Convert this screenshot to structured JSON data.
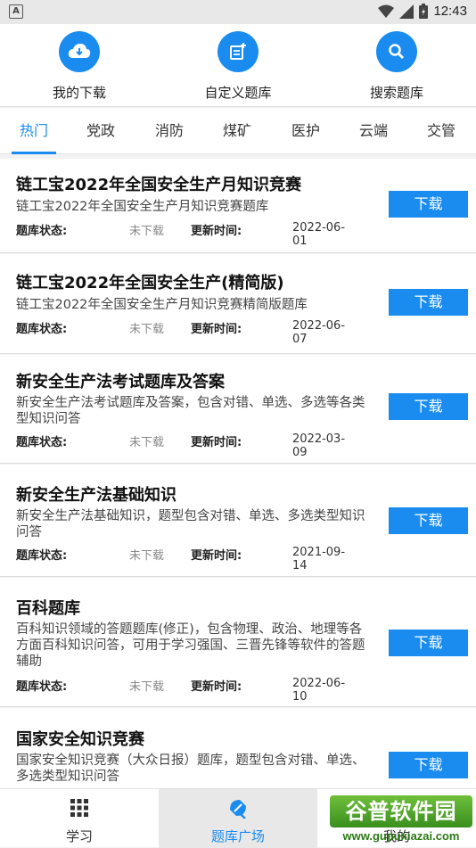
{
  "status_bar": {
    "notification_glyph": "A",
    "time": "12:43"
  },
  "quick_actions": [
    {
      "label": "我的下载",
      "icon": "cloud-download-icon"
    },
    {
      "label": "自定义题库",
      "icon": "add-note-icon"
    },
    {
      "label": "搜索题库",
      "icon": "search-icon"
    }
  ],
  "tabs": [
    "热门",
    "党政",
    "消防",
    "煤矿",
    "医护",
    "云端",
    "交管"
  ],
  "active_tab": "热门",
  "labels": {
    "status_key": "题库状态:",
    "update_key": "更新时间:",
    "download_button": "下载"
  },
  "items": [
    {
      "title": "链工宝2022年全国安全生产月知识竞赛",
      "desc": "链工宝2022年全国安全生产月知识竞赛题库",
      "status": "未下载",
      "date": "2022-06-01"
    },
    {
      "title": "链工宝2022年全国安全生产(精简版)",
      "desc": "链工宝2022年全国安全生产月知识竞赛精简版题库",
      "status": "未下载",
      "date": "2022-06-07"
    },
    {
      "title": "新安全生产法考试题库及答案",
      "desc": "新安全生产法考试题库及答案，包含对错、单选、多选等各类型知识问答",
      "status": "未下载",
      "date": "2022-03-09"
    },
    {
      "title": "新安全生产法基础知识",
      "desc": "新安全生产法基础知识，题型包含对错、单选、多选类型知识问答",
      "status": "未下载",
      "date": "2021-09-14"
    },
    {
      "title": "百科题库",
      "desc": "百科知识领域的答题题库(修正)，包含物理、政治、地理等各方面百科知识问答，可用于学习强国、三晋先锋等软件的答题辅助",
      "status": "未下载",
      "date": "2022-06-10"
    },
    {
      "title": "国家安全知识竞赛",
      "desc": "国家安全知识竞赛（大众日报）题库，题型包含对错、单选、多选类型知识问答",
      "status": "",
      "date": ""
    }
  ],
  "bottom_nav": [
    {
      "label": "学习",
      "icon": "grid-icon"
    },
    {
      "label": "题库广场",
      "icon": "square-icon"
    },
    {
      "label": "我的",
      "icon": "person-icon"
    }
  ],
  "active_bottom": "题库广场",
  "watermark": {
    "main": "谷普软件园",
    "url": "www.gupuxiazai.com"
  },
  "colors": {
    "accent": "#1a8cf0",
    "background": "#f2f2f2"
  }
}
